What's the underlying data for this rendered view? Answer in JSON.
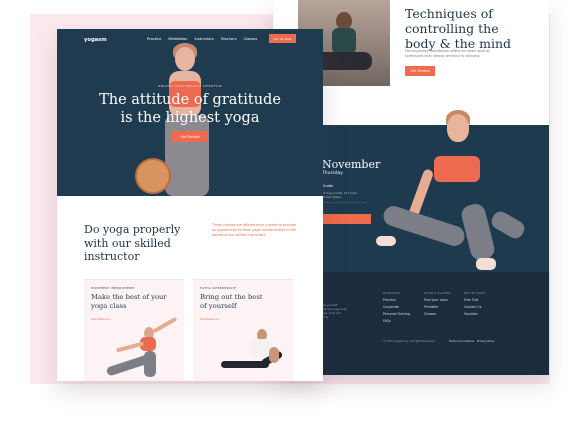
{
  "colors": {
    "accent": "#ef6b4d",
    "navy": "#1f3b4f",
    "page_bg": "#fbe9ee"
  },
  "back_page": {
    "feature": {
      "title_line1": "Techniques of",
      "title_line2": "controlling the",
      "title_line3": "body & the mind",
      "body": "Feminyssima meditation offers an open spot at scheduled that simply arriving in stillness",
      "button": "Get Started"
    },
    "event": {
      "date": "November",
      "weekday": "Thursday",
      "studio": "Studio",
      "address": "At Yoga Center 123 Suite United States"
    },
    "footer": {
      "left_text": "Let yourself practice yoga daily rest, mind and body",
      "columns": [
        {
          "head": "WORKSHOP",
          "items": [
            "Practice",
            "Corporate",
            "Personal Training",
            "FAQs"
          ]
        },
        {
          "head": "CLASS & CLASSES",
          "items": [
            "Find your class",
            "Printable",
            "Classes"
          ]
        },
        {
          "head": "GET IN TOUCH",
          "items": [
            "Free Trial",
            "Contact Us",
            "Vacation"
          ]
        }
      ],
      "copyright": "© 2021 Yogasm Inc. All rights Reserved",
      "terms": "Terms & Conditions",
      "privacy": "Privacy Policy"
    }
  },
  "front_page": {
    "nav": {
      "logo": "yogasm",
      "links": [
        "Practice",
        "Meditation",
        "Instructors",
        "Teachers",
        "Classes"
      ],
      "cta": "Join Us Now"
    },
    "hero": {
      "eyebrow": "UNLOCK YOUR HEALTHY LIFESTYLE",
      "title_line1": "The attitude of gratitude",
      "title_line2": "is the highest yoga",
      "button": "Get Started"
    },
    "intro": {
      "title_line1": "Do yoga properly",
      "title_line2": "with our skilled",
      "title_line3": "instructor",
      "text": "These classes are offered once a week to provide an opportunity to learn yoga fundamentals in the details of our skilled instructors"
    },
    "cards": [
      {
        "eyebrow": "MOVEMENT IMPROVEMENT",
        "title_line1": "Make the best of your",
        "title_line2": "yoga class",
        "link": "See Balance ›"
      },
      {
        "eyebrow": "HATHA INTERMEDIATE",
        "title_line1": "Bring out the best",
        "title_line2": "of yourself",
        "link": "See Balance ›"
      }
    ]
  }
}
